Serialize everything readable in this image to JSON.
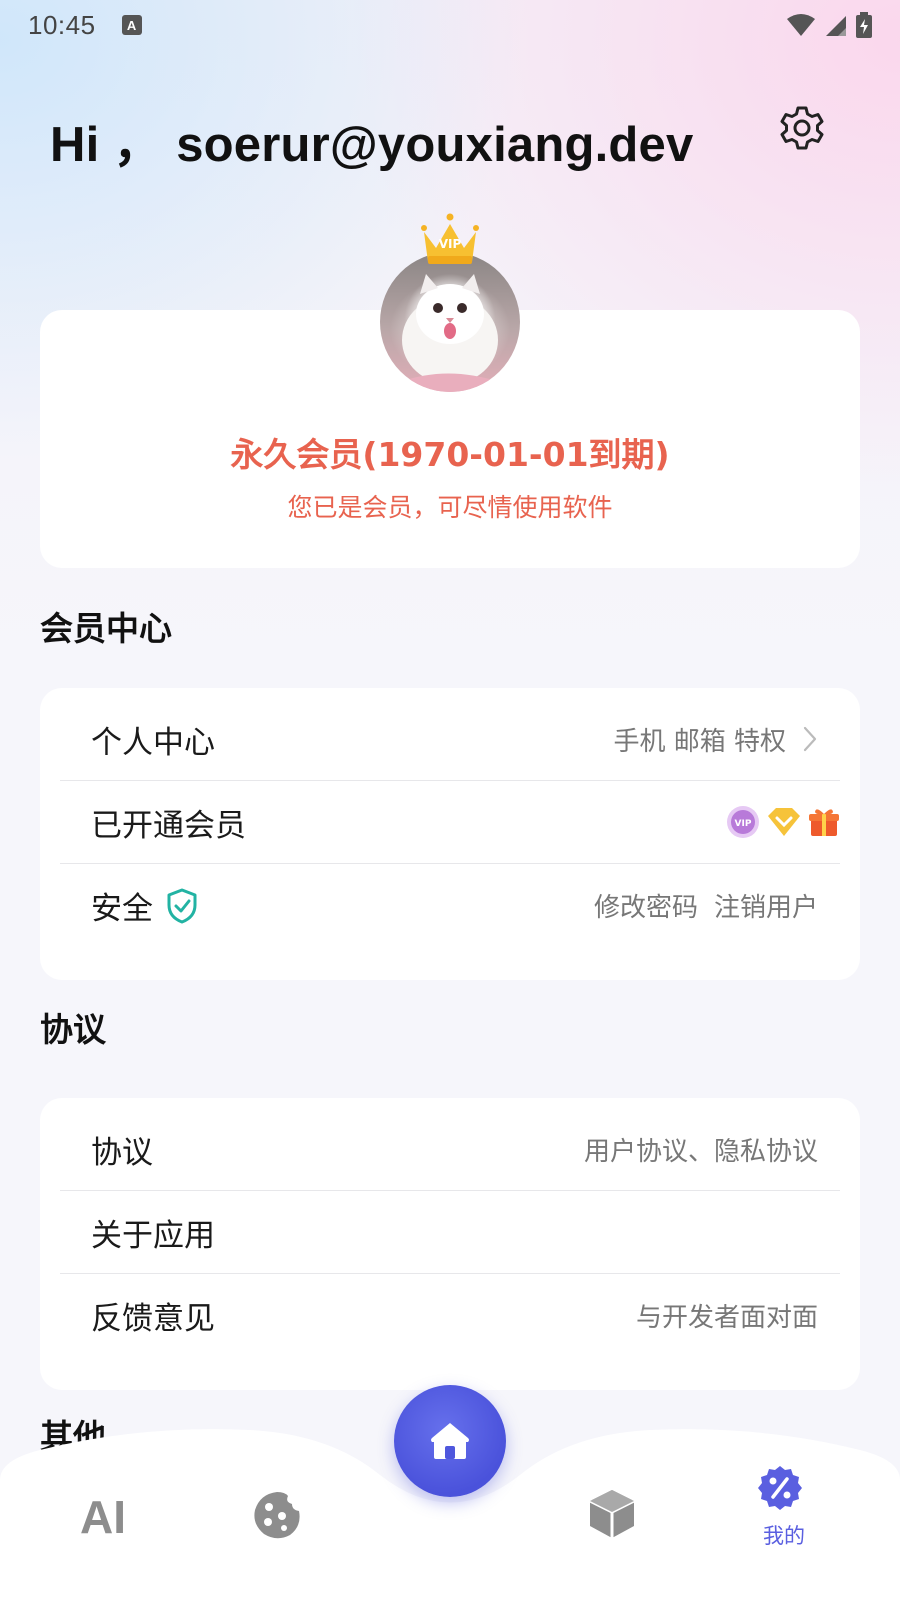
{
  "status_bar": {
    "time": "10:45",
    "notif_letter": "A"
  },
  "header": {
    "greeting": "Hi ，  soerur@youxiang.dev"
  },
  "profile": {
    "crown_text": "VIP",
    "membership_title": "永久会员(1970-01-01到期)",
    "membership_sub": "您已是会员，可尽情使用软件"
  },
  "member_center": {
    "title": "会员中心",
    "rows": [
      {
        "label": "个人中心",
        "hint": "手机 邮箱 特权"
      },
      {
        "label": "已开通会员",
        "hint": "",
        "badges": [
          "vip-badge-icon",
          "diamond-icon",
          "gift-icon"
        ]
      },
      {
        "label": "安全",
        "hint_a": "修改密码",
        "hint_b": "注销用户"
      }
    ]
  },
  "agreements": {
    "title": "协议",
    "rows": [
      {
        "label": "协议",
        "hint": "用户协议、隐私协议"
      },
      {
        "label": "关于应用",
        "hint": ""
      },
      {
        "label": "反馈意见",
        "hint": "与开发者面对面"
      }
    ]
  },
  "other": {
    "title": "其他"
  },
  "tabbar": {
    "tabs": [
      {
        "name": "ai",
        "text": "AI"
      },
      {
        "name": "cookie",
        "text": ""
      },
      {
        "name": "home",
        "text": ""
      },
      {
        "name": "box",
        "text": ""
      },
      {
        "name": "mine",
        "text": "我的"
      }
    ],
    "active_color": "#5a5fe0",
    "inactive_color": "#8d8d8d"
  },
  "colors": {
    "accent": "#4a52db",
    "member_red": "#e8634f",
    "shield_teal": "#22b3a3"
  }
}
